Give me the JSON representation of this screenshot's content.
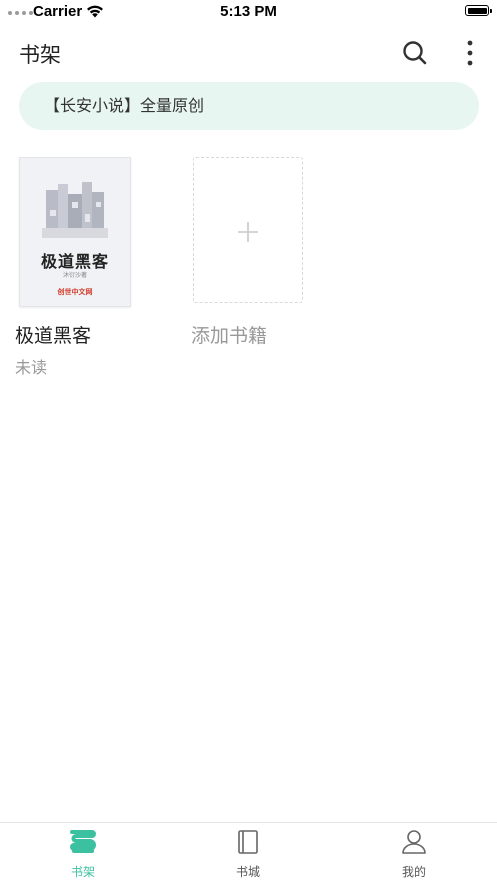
{
  "status_bar": {
    "carrier": "Carrier",
    "time": "5:13 PM",
    "battery_level": 1.0
  },
  "nav": {
    "title": "书架",
    "search_icon": "search-icon",
    "more_icon": "more-vertical-icon"
  },
  "banner": {
    "text": "【长安小说】全量原创"
  },
  "books": [
    {
      "cover_title": "极道黑客",
      "cover_author": "沐衍沙著",
      "cover_publisher": "创世中文网",
      "name": "极道黑客",
      "status": "未读"
    }
  ],
  "add_book": {
    "label": "添加书籍",
    "icon": "plus-icon"
  },
  "tabs": [
    {
      "label": "书架",
      "icon": "bookshelf-icon",
      "active": true
    },
    {
      "label": "书城",
      "icon": "book-icon",
      "active": false
    },
    {
      "label": "我的",
      "icon": "user-icon",
      "active": false
    }
  ],
  "colors": {
    "accent": "#3cc1a0",
    "banner_bg": "#e8f6f2",
    "muted_text": "#999999"
  }
}
